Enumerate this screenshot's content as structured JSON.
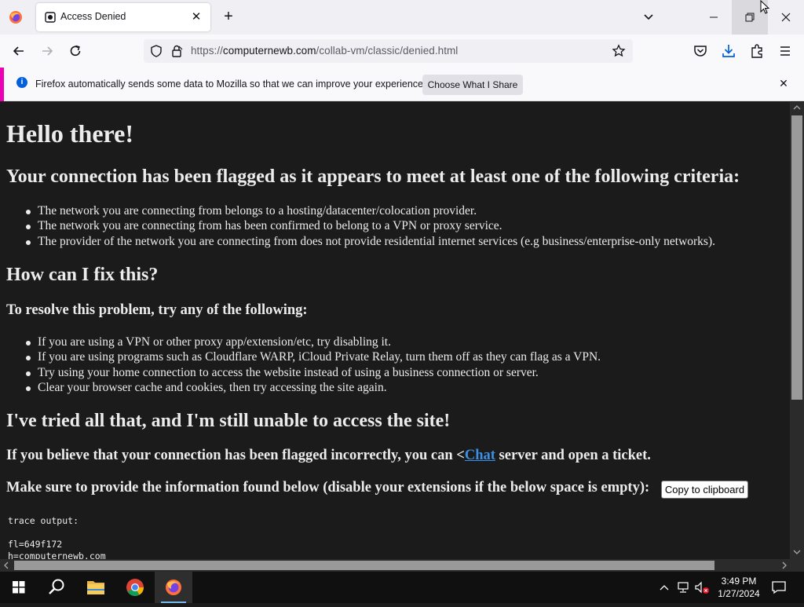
{
  "browser": {
    "tab_title": "Access Denied",
    "url_prefix": "https://",
    "url_domain": "computernewb.com",
    "url_path": "/collab-vm/classic/denied.html"
  },
  "notification": {
    "message": "Firefox automatically sends some data to Mozilla so that we can improve your experience.",
    "button_label": "Choose What I Share"
  },
  "page": {
    "h1": "Hello there!",
    "h2_flagged": "Your connection has been flagged as it appears to meet at least one of the following criteria:",
    "criteria": [
      "The network you are connecting from belongs to a hosting/datacenter/colocation provider.",
      "The network you are connecting from has been confirmed to belong to a VPN or proxy service.",
      "The provider of the network you are connecting from does not provide residential internet services (e.g business/enterprise-only networks)."
    ],
    "h2_fix": "How can I fix this?",
    "h3_resolve": "To resolve this problem, try any of the following:",
    "fixes": [
      "If you are using a VPN or other proxy app/extension/etc, try disabling it.",
      "If you are using programs such as Cloudflare WARP, iCloud Private Relay, turn them off as they can flag as a VPN.",
      "Try using your home connection to access the website instead of using a business connection or server.",
      "Clear your browser cache and cookies, then try accessing the site again."
    ],
    "h2_tried": "I've tried all that, and I'm still unable to access the site!",
    "incorrect_before": "If you believe that your connection has been flagged incorrectly, you can <",
    "incorrect_link": "Chat",
    "incorrect_after": " server and open a ticket.",
    "provide_info": "Make sure to provide the information found below (disable your extensions if the below space is empty):",
    "copy_button": "Copy to clipboard",
    "trace_label": "trace output:",
    "trace_lines": [
      "fl=649f172",
      "h=computernewb.com"
    ]
  },
  "taskbar": {
    "time": "3:49 PM",
    "date": "1/27/2024"
  }
}
